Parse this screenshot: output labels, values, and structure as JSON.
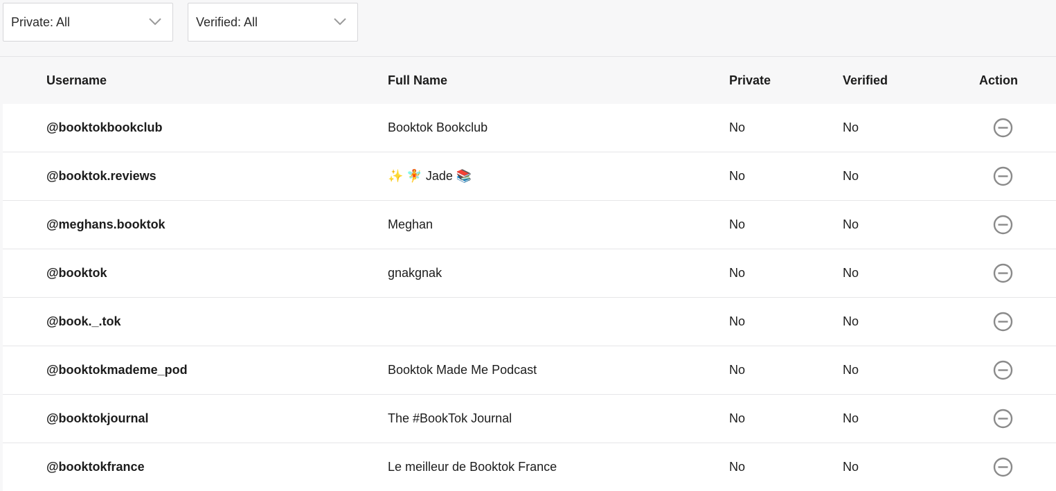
{
  "filters": {
    "private_label": "Private: All",
    "verified_label": "Verified: All"
  },
  "table": {
    "headers": {
      "username": "Username",
      "full_name": "Full Name",
      "private": "Private",
      "verified": "Verified",
      "action": "Action"
    },
    "rows": [
      {
        "username": "@booktokbookclub",
        "full_name": "Booktok Bookclub",
        "private": "No",
        "verified": "No"
      },
      {
        "username": "@booktok.reviews",
        "full_name": "✨ 🧚 Jade 📚",
        "private": "No",
        "verified": "No"
      },
      {
        "username": "@meghans.booktok",
        "full_name": "Meghan",
        "private": "No",
        "verified": "No"
      },
      {
        "username": "@booktok",
        "full_name": "gnakgnak",
        "private": "No",
        "verified": "No"
      },
      {
        "username": "@book._.tok",
        "full_name": "",
        "private": "No",
        "verified": "No"
      },
      {
        "username": "@booktokmademe_pod",
        "full_name": "Booktok Made Me Podcast",
        "private": "No",
        "verified": "No"
      },
      {
        "username": "@booktokjournal",
        "full_name": "The #BookTok Journal",
        "private": "No",
        "verified": "No"
      },
      {
        "username": "@booktokfrance",
        "full_name": "Le meilleur de Booktok France",
        "private": "No",
        "verified": "No"
      }
    ],
    "action_icon": "minus-circle-icon"
  },
  "colors": {
    "background": "#f7f7f8",
    "row_background": "#ffffff",
    "icon_gray": "#8a8a8a"
  }
}
